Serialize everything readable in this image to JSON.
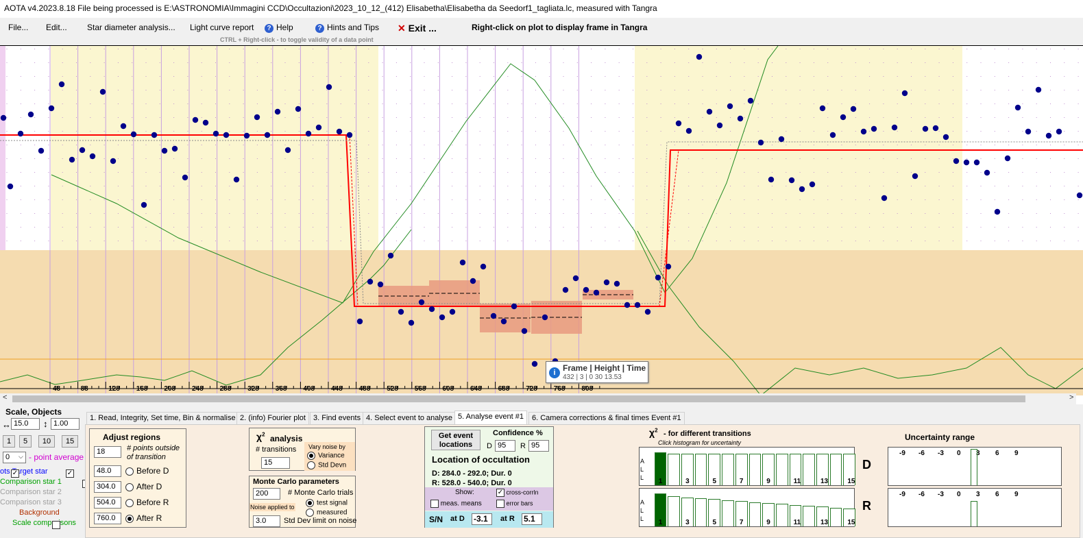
{
  "title": "AOTA v4.2023.8.18     File being processed is E:\\ASTRONOMIA\\Immagini CCD\\Occultazioni\\2023_10_12_(412) Elisabetha\\Elisabetha da Seedorf1_tagliata.lc, measured with Tangra",
  "menu": {
    "file": "File...",
    "edit": "Edit...",
    "star_diameter": "Star diameter analysis...",
    "light_curve": "Light curve report",
    "help": "Help",
    "hints": "Hints and Tips",
    "exit": "Exit ...",
    "rightclick_hint": "Right-click on plot to display frame in Tangra",
    "ctrl_hint": "CTRL + Right-click  -  to toggle validity of a data point"
  },
  "plot": {
    "x_ticks": [
      "48",
      "88",
      "128",
      "168",
      "208",
      "248",
      "288",
      "328",
      "368",
      "408",
      "448",
      "488",
      "528",
      "568",
      "608",
      "648",
      "688",
      "728",
      "768",
      "808"
    ],
    "tooltip_title": "Frame | Height | Time",
    "tooltip_value": "432 |  3 |  0 30 13.53"
  },
  "colors": {
    "data_point": "#00008b",
    "model_line": "#ff0000",
    "comparison_line": "#228b22",
    "baseline_region": "#fbf6d0",
    "event_region": "#f5dcb0",
    "hist_fill": "#006400"
  },
  "left_panel": {
    "title": "Scale,  Objects",
    "scale_x": "15.0",
    "scale_y": "1.00",
    "bin_buttons": [
      "1",
      "5",
      "10",
      "15"
    ],
    "point_avg_value": "0",
    "point_avg_label": "- point average",
    "objects": [
      {
        "label": "ots  Target star",
        "color": "#0000ff",
        "checked": true
      },
      {
        "label": "Comparison star 1",
        "color": "#00a000",
        "checked": false
      },
      {
        "label": "Comparison star 2",
        "color": "#a0a0a0",
        "checked": false
      },
      {
        "label": "Comparison star 3",
        "color": "#a0a0a0",
        "checked": false
      },
      {
        "label": "Background",
        "color": "#b03000",
        "checked": false
      },
      {
        "label": "Scale comparisons",
        "color": "#00a000",
        "checked": false
      }
    ]
  },
  "tabs": [
    "1.  Read, Integrity, Set time, Bin & normalise",
    "2. (info)  Fourier plot",
    "3. Find events",
    "4. Select event to analyse",
    "5. Analyse event #1",
    "6. Camera corrections & final times Event #1"
  ],
  "adjust": {
    "title": "Adjust regions",
    "points_value": "18",
    "points_label": "# points outside of transition",
    "rows": [
      {
        "value": "48.0",
        "label": "Before D",
        "selected": false
      },
      {
        "value": "304.0",
        "label": "After D",
        "selected": false
      },
      {
        "value": "504.0",
        "label": "Before R",
        "selected": false
      },
      {
        "value": "760.0",
        "label": "After R",
        "selected": true
      }
    ]
  },
  "chi": {
    "title": "analysis",
    "transitions_label": "# transitions",
    "transitions_value": "15",
    "vary_label": "Vary noise by",
    "variance": "Variance",
    "stddev": "Std Devn"
  },
  "monte": {
    "title": "Monte Carlo parameters",
    "trials_value": "200",
    "trials_label": "# Monte Carlo trials",
    "noise_label": "Noise applied to",
    "test_signal": "test signal",
    "measured": "measured",
    "limit_value": "3.0",
    "limit_label": "Std Dev limit on noise"
  },
  "location": {
    "get_button": "Get event locations",
    "confidence_label": "Confidence %",
    "d_label": "D",
    "d_value": "95",
    "r_label": "R",
    "r_value": "95",
    "title": "Location of occultation",
    "d_line": "D: 284.0 - 292.0; Dur. 0",
    "r_line": "R: 528.0 - 540.0; Dur. 0",
    "show_label": "Show:",
    "cross_corr": "cross-corrln",
    "meas_means": "meas. means",
    "error_bars": "error bars",
    "sn_label": "S/N",
    "at_d": "at D",
    "sn_d": "-3.1",
    "at_r": "at R",
    "sn_r": "5.1"
  },
  "transitions_hist": {
    "title": "- for different transitions",
    "subtitle": "Click histogram for uncertainty",
    "side_label": "A\nL\nL",
    "labels": [
      "1",
      "3",
      "5",
      "7",
      "9",
      "11",
      "13",
      "15"
    ],
    "d_label": "D",
    "r_label": "R",
    "d_levels": [
      1,
      1,
      1,
      1,
      1,
      1,
      1,
      1,
      1,
      1,
      1,
      1,
      1,
      1,
      1,
      1
    ],
    "r_levels": [
      1,
      0.98,
      0.95,
      0.92,
      0.89,
      0.86,
      0.83,
      0.8,
      0.77,
      0.74,
      0.71,
      0.68,
      0.65,
      0.62,
      0.59,
      0.56
    ]
  },
  "uncertainty": {
    "title": "Uncertainty range",
    "ticks": [
      "-9",
      "-6",
      "-3",
      "0",
      "3",
      "6",
      "9"
    ]
  }
}
